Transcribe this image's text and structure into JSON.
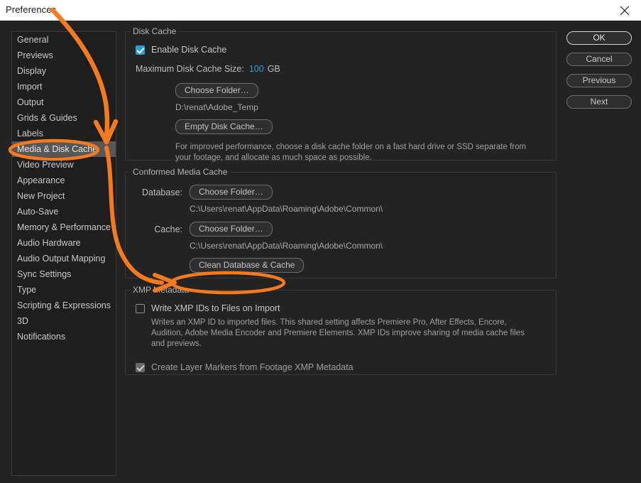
{
  "window": {
    "title": "Preferences",
    "close_icon": "close-icon"
  },
  "sidebar": {
    "items": [
      {
        "label": "General",
        "selected": false
      },
      {
        "label": "Previews",
        "selected": false
      },
      {
        "label": "Display",
        "selected": false
      },
      {
        "label": "Import",
        "selected": false
      },
      {
        "label": "Output",
        "selected": false
      },
      {
        "label": "Grids & Guides",
        "selected": false
      },
      {
        "label": "Labels",
        "selected": false
      },
      {
        "label": "Media & Disk Cache",
        "selected": true
      },
      {
        "label": "Video Preview",
        "selected": false
      },
      {
        "label": "Appearance",
        "selected": false
      },
      {
        "label": "New Project",
        "selected": false
      },
      {
        "label": "Auto-Save",
        "selected": false
      },
      {
        "label": "Memory & Performance",
        "selected": false
      },
      {
        "label": "Audio Hardware",
        "selected": false
      },
      {
        "label": "Audio Output Mapping",
        "selected": false
      },
      {
        "label": "Sync Settings",
        "selected": false
      },
      {
        "label": "Type",
        "selected": false
      },
      {
        "label": "Scripting & Expressions",
        "selected": false
      },
      {
        "label": "3D",
        "selected": false
      },
      {
        "label": "Notifications",
        "selected": false
      }
    ]
  },
  "disk_cache": {
    "group_label": "Disk Cache",
    "enable_label": "Enable Disk Cache",
    "enable_checked": true,
    "max_size_label": "Maximum Disk Cache Size:",
    "max_size_value": "100",
    "max_size_unit": "GB",
    "choose_folder_label": "Choose Folder…",
    "folder_path": "D:\\renat\\Adobe_Temp",
    "empty_cache_label": "Empty Disk Cache…",
    "description": "For improved performance, choose a disk cache folder on a fast hard drive or SSD separate from your footage, and allocate as much space as possible."
  },
  "conformed_media_cache": {
    "group_label": "Conformed Media Cache",
    "database_label": "Database:",
    "database_button": "Choose Folder…",
    "database_path": "C:\\Users\\renat\\AppData\\Roaming\\Adobe\\Common\\",
    "cache_label": "Cache:",
    "cache_button": "Choose Folder…",
    "cache_path": "C:\\Users\\renat\\AppData\\Roaming\\Adobe\\Common\\",
    "clean_button": "Clean Database & Cache"
  },
  "xmp_metadata": {
    "group_label": "XMP Metadata",
    "write_ids_label": "Write XMP IDs to Files on Import",
    "write_ids_checked": false,
    "write_ids_description": "Writes an XMP ID to imported files. This shared setting affects Premiere Pro, After Effects, Encore, Audition, Adobe Media Encoder and Premiere Elements. XMP IDs improve sharing of media cache files and previews.",
    "layer_markers_label": "Create Layer Markers from Footage XMP Metadata",
    "layer_markers_checked": true
  },
  "buttons": {
    "ok": "OK",
    "cancel": "Cancel",
    "previous": "Previous",
    "next": "Next"
  },
  "annotations": {
    "color": "#F47A20",
    "arrow_to_sidebar_item": "Media & Disk Cache",
    "highlight_sidebar_item": "Media & Disk Cache",
    "arrow_to_button": "Clean Database & Cache",
    "highlight_button": "Clean Database & Cache"
  }
}
